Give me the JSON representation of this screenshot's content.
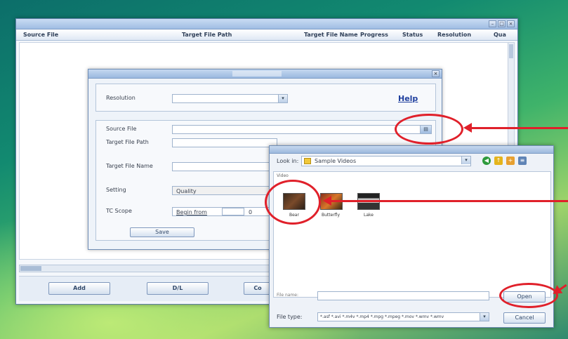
{
  "colors": {
    "annotation_red": "#e0202a",
    "window_border": "#5d7fa8",
    "link_blue": "#1f3f9e"
  },
  "main_window": {
    "columns": [
      "Source File",
      "Target File Path",
      "Target File Name",
      "Progress",
      "Status",
      "Resolution",
      "Qua"
    ],
    "controls": [
      "minimize",
      "maximize",
      "close"
    ],
    "buttons": {
      "add": "Add",
      "second": "D/L",
      "third": "Co"
    }
  },
  "conversion_dialog": {
    "resolution_label": "Resolution",
    "help_link": "Help",
    "source_file_label": "Source File",
    "target_path_label": "Target File Path",
    "target_name_label": "Target File Name",
    "setting_label": "Setting",
    "setting_value": "Quality",
    "tc_scope_label": "TC Scope",
    "begin_from_label": "Begin from",
    "begin_value": "0",
    "browse_icon": "folder-icon",
    "action_button": "Save"
  },
  "open_dialog": {
    "look_in_label": "Look in:",
    "look_in_value": "Sample Videos",
    "group_label": "Video",
    "files": [
      "Bear",
      "Butterfly",
      "Lake"
    ],
    "file_name_label": "File name:",
    "file_type_label": "File type:",
    "file_type_value": "*.asf *.avi *.m4v *.mp4 *.mpg *.mpeg *.mov *.wmv *.wmv",
    "open_button": "Open",
    "cancel_button": "Cancel"
  }
}
